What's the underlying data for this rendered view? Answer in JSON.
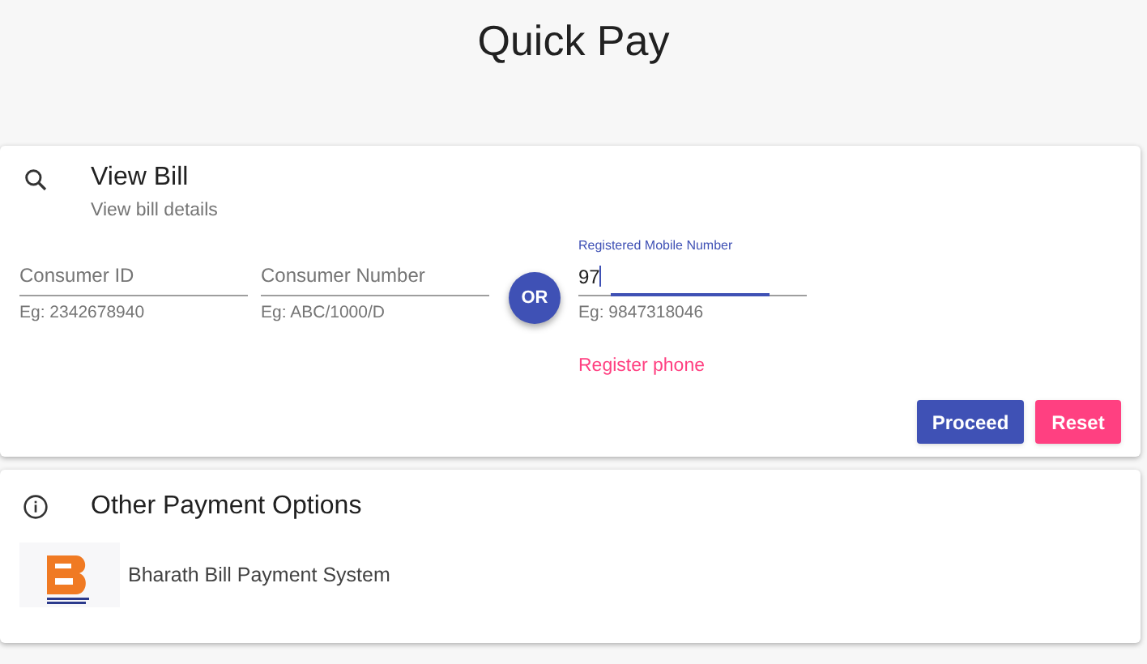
{
  "page_title": "Quick Pay",
  "view_bill": {
    "title": "View Bill",
    "subtitle": "View bill details",
    "fields": [
      {
        "label": "Consumer ID",
        "hint": "Eg: 2342678940",
        "focused": false
      },
      {
        "label": "Consumer Number",
        "hint": "Eg: ABC/1000/D",
        "focused": false
      }
    ],
    "or_badge": "OR",
    "mobile_field": {
      "label": "Registered Mobile Number",
      "value": "97",
      "hint": "Eg: 9847318046",
      "focused": true
    },
    "register_link": "Register phone",
    "buttons": [
      {
        "label": "Proceed",
        "kind": "primary"
      },
      {
        "label": "Reset",
        "kind": "accent"
      }
    ]
  },
  "other_options": {
    "title": "Other Payment Options",
    "items": [
      {
        "label": "Bharath Bill Payment System"
      }
    ]
  }
}
